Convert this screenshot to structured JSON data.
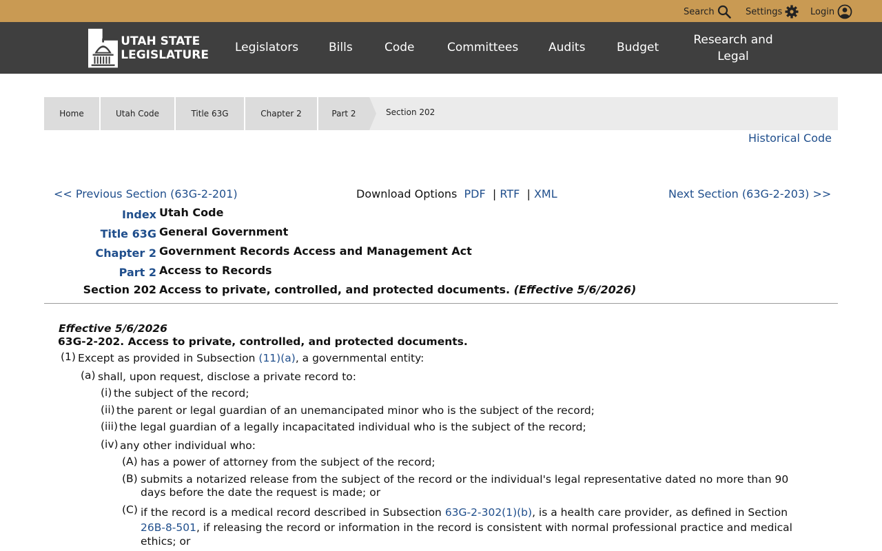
{
  "topbar": {
    "search_label": "Search",
    "settings_label": "Settings",
    "login_label": "Login",
    "icons": [
      "search-icon",
      "gear-icon",
      "user-icon"
    ]
  },
  "nav": {
    "logo_line1": "UTAH STATE",
    "logo_line2": "LEGISLATURE",
    "items": [
      "Legislators",
      "Bills",
      "Code",
      "Committees",
      "Audits",
      "Budget"
    ],
    "research_line1": "Research and",
    "research_line2": "Legal"
  },
  "breadcrumb": [
    "Home",
    "Utah Code",
    "Title 63G",
    "Chapter 2",
    "Part 2",
    "Section 202"
  ],
  "historical_link": "Historical Code",
  "section_nav": {
    "prev": "<< Previous Section (63G-2-201)",
    "download_label": "Download Options",
    "pdf": "PDF",
    "rtf": "RTF",
    "xml": "XML",
    "sep": "|",
    "next": "Next Section (63G-2-203) >>"
  },
  "index": [
    {
      "label": "Index",
      "value": "Utah Code"
    },
    {
      "label": "Title 63G",
      "value": "General Government"
    },
    {
      "label": "Chapter 2",
      "value": "Government Records Access and Management Act"
    },
    {
      "label": "Part 2",
      "value": "Access to Records"
    },
    {
      "label": "Section 202",
      "value": "Access to private, controlled, and protected documents.",
      "effective": "(Effective 5/6/2026)"
    }
  ],
  "code": {
    "effective": "Effective 5/6/2026",
    "heading": "63G-2-202.  Access to private, controlled, and protected documents.",
    "p1_num": "(1)",
    "p1_pre": "Except as provided in Subsection ",
    "p1_link": "(11)(a)",
    "p1_post": ", a governmental entity:",
    "pa_num": "(a)",
    "pa_text": "shall, upon request, disclose a private record to:",
    "i_num": "(i)",
    "i_text": "the subject of the record;",
    "ii_num": "(ii)",
    "ii_text": "the parent or legal guardian of an unemancipated minor who is the subject of the record;",
    "iii_num": "(iii)",
    "iii_text": "the legal guardian of a legally incapacitated individual who is the subject of the record;",
    "iv_num": "(iv)",
    "iv_text": "any other individual who:",
    "A_num": "(A)",
    "A_text": "has a power of attorney from the subject of the record;",
    "B_num": "(B)",
    "B_text_1": "submits a notarized release from the subject of the record or the individual's legal representative dated no more than 90",
    "B_text_2": "days before the date the request is made; or",
    "C_num": "(C)",
    "C_pre": "if the record is a medical record described in Subsection ",
    "C_link1": "63G-2-302(1)(b)",
    "C_mid": ", is a health care provider, as defined in Section",
    "C_link2": "26B-8-501",
    "C_post": ", if releasing the record or information in the record is consistent with normal professional practice and medical",
    "C_end": "ethics; or"
  }
}
